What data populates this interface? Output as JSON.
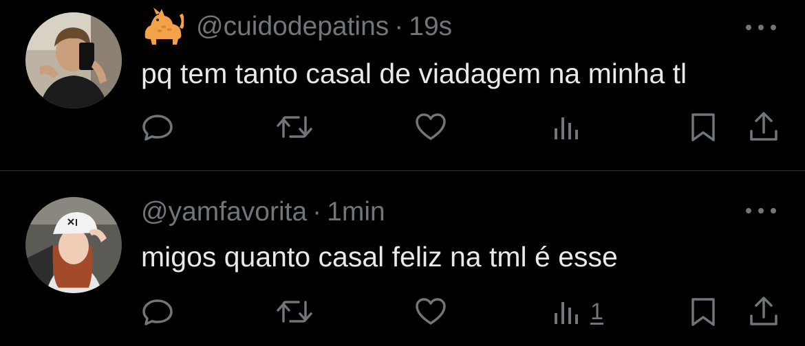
{
  "tweets": [
    {
      "handle": "@cuidodepatins",
      "separator": "·",
      "time": "19s",
      "text": "pq tem tanto casal de viadagem na minha tl",
      "name_emoji": "cat-emoji",
      "views_count": "",
      "avatar": "profile-photo-mirror-selfie"
    },
    {
      "handle": "@yamfavorita",
      "separator": "·",
      "time": "1min",
      "text": "migos quanto casal feliz na tml é esse",
      "views_count": "1",
      "avatar": "profile-photo-girl-with-cap"
    }
  ],
  "icons": {
    "reply": "reply-icon",
    "retweet": "retweet-icon",
    "like": "heart-icon",
    "views": "views-icon",
    "bookmark": "bookmark-icon",
    "share": "share-icon",
    "more": "more-icon"
  },
  "colors": {
    "background": "#000000",
    "text": "#e7e9ea",
    "secondary": "#71767b",
    "divider": "#2f3336"
  }
}
